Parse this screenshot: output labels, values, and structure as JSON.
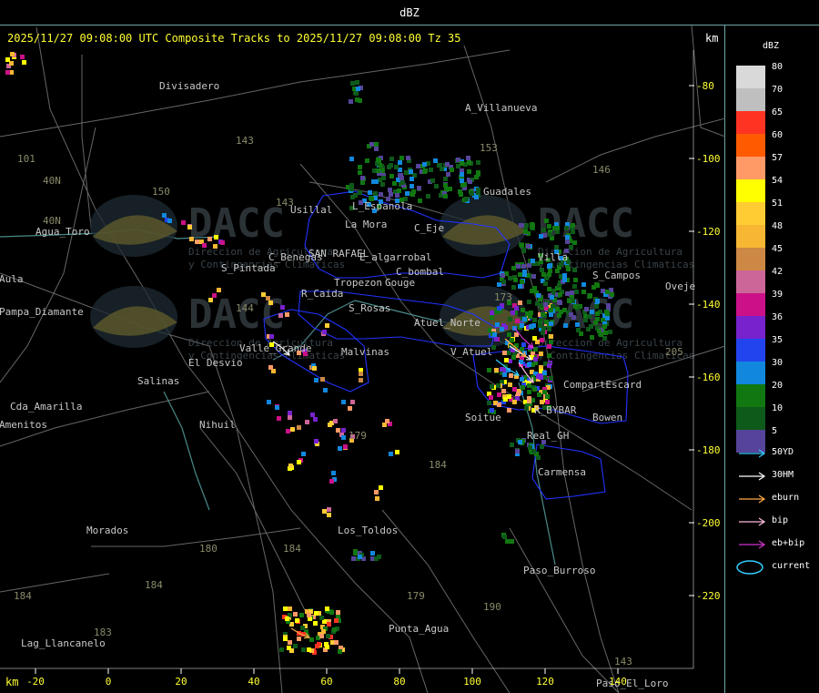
{
  "colors": {
    "frame": "#6fa6a6",
    "header": "#ffff33",
    "boundary": "#2233ff",
    "road": "#666666",
    "place_label": "#c8c8c8",
    "route_label": "#8a8a6a"
  },
  "top_bar": {
    "title": "dBZ"
  },
  "header": {
    "text": "2025/11/27 09:08:00 UTC Composite Tracks to 2025/11/27 09:08:00 Tz 35",
    "km_right": "km",
    "km_bottom": "km"
  },
  "axes": {
    "x_ticks": [
      "-20",
      "0",
      "20",
      "40",
      "60",
      "80",
      "100",
      "120",
      "140"
    ],
    "x_values": [
      -20,
      0,
      20,
      40,
      60,
      80,
      100,
      120,
      140
    ],
    "y_ticks": [
      "-80",
      "-100",
      "-120",
      "-140",
      "-160",
      "-180",
      "-200",
      "-220"
    ],
    "y_values": [
      -80,
      -100,
      -120,
      -140,
      -160,
      -180,
      -200,
      -220
    ],
    "x_range": [
      -30,
      160
    ],
    "y_range": [
      -75,
      -248
    ]
  },
  "legend": {
    "title": "dBZ",
    "items": [
      {
        "value": "80",
        "color": "#d9d9d9"
      },
      {
        "value": "70",
        "color": "#bfbfbf"
      },
      {
        "value": "65",
        "color": "#ff3322"
      },
      {
        "value": "60",
        "color": "#ff5a00"
      },
      {
        "value": "57",
        "color": "#ff9966"
      },
      {
        "value": "54",
        "color": "#ffff00"
      },
      {
        "value": "51",
        "color": "#ffcc33"
      },
      {
        "value": "48",
        "color": "#f7b733"
      },
      {
        "value": "45",
        "color": "#cc8844"
      },
      {
        "value": "42",
        "color": "#cc6699"
      },
      {
        "value": "39",
        "color": "#cc1188"
      },
      {
        "value": "36",
        "color": "#7722cc"
      },
      {
        "value": "35",
        "color": "#2244ee"
      },
      {
        "value": "30",
        "color": "#1188dd"
      },
      {
        "value": "20",
        "color": "#117711"
      },
      {
        "value": "10",
        "color": "#0e5a1a"
      },
      {
        "value": "5",
        "color": "#554499"
      }
    ],
    "tracks": [
      {
        "label": "50YD",
        "color": "#33ccff",
        "icon": "arrow"
      },
      {
        "label": "30HM",
        "color": "#ffffff",
        "icon": "arrow"
      },
      {
        "label": "eburn",
        "color": "#ffaa44",
        "icon": "arrow"
      },
      {
        "label": "bip",
        "color": "#ffbbdd",
        "icon": "arrow"
      },
      {
        "label": "eb+bip",
        "color": "#cc33cc",
        "icon": "arrow"
      },
      {
        "label": "current",
        "color": "#33ccff",
        "icon": "ellipse"
      }
    ]
  },
  "places": [
    {
      "name": "Divisadero",
      "x": 14,
      "y": -81
    },
    {
      "name": "A_Villanueva",
      "x": 98,
      "y": -87
    },
    {
      "name": "Guadales",
      "x": 103,
      "y": -110
    },
    {
      "name": "Usillal",
      "x": 50,
      "y": -115
    },
    {
      "name": "L_Espanola",
      "x": 67,
      "y": -114
    },
    {
      "name": "Agua_Toro",
      "x": -20,
      "y": -121
    },
    {
      "name": "C_Eje",
      "x": 84,
      "y": -120
    },
    {
      "name": "Villa",
      "x": 118,
      "y": -128
    },
    {
      "name": "S_Campos",
      "x": 133,
      "y": -133
    },
    {
      "name": "Oveje",
      "x": 153,
      "y": -136
    },
    {
      "name": "Aula",
      "x": -30,
      "y": -134
    },
    {
      "name": "Pampa_Diamante",
      "x": -30,
      "y": -143
    },
    {
      "name": "La Mora",
      "x": 65,
      "y": -119
    },
    {
      "name": "C_Benegas",
      "x": 44,
      "y": -128
    },
    {
      "name": "SAN RAFAEL",
      "x": 55,
      "y": -127
    },
    {
      "name": "E_algarrobal",
      "x": 69,
      "y": -128
    },
    {
      "name": "C_bombal",
      "x": 79,
      "y": -132
    },
    {
      "name": "Tropezon",
      "x": 62,
      "y": -135
    },
    {
      "name": "Gouge",
      "x": 76,
      "y": -135
    },
    {
      "name": "R_Caida",
      "x": 53,
      "y": -138
    },
    {
      "name": "S_Rosas",
      "x": 66,
      "y": -142
    },
    {
      "name": "S_Pintada",
      "x": 31,
      "y": -131
    },
    {
      "name": "Atuel_Norte",
      "x": 84,
      "y": -146
    },
    {
      "name": "El Desvio",
      "x": 22,
      "y": -157
    },
    {
      "name": "Valle_Grande",
      "x": 36,
      "y": -153
    },
    {
      "name": "Malvinas",
      "x": 64,
      "y": -154
    },
    {
      "name": "V_Atuel",
      "x": 94,
      "y": -154
    },
    {
      "name": "Salinas",
      "x": 8,
      "y": -162
    },
    {
      "name": "CompartEscard",
      "x": 125,
      "y": -163
    },
    {
      "name": "Cda_Amarilla",
      "x": -27,
      "y": -169
    },
    {
      "name": "Soitue",
      "x": 98,
      "y": -172
    },
    {
      "name": "R_BYBAR",
      "x": 117,
      "y": -170
    },
    {
      "name": "Bowen",
      "x": 133,
      "y": -172
    },
    {
      "name": "Nihuil",
      "x": 25,
      "y": -174
    },
    {
      "name": "Amenitos",
      "x": -30,
      "y": -174
    },
    {
      "name": "Real_GH",
      "x": 115,
      "y": -177
    },
    {
      "name": "Carmensa",
      "x": 118,
      "y": -187
    },
    {
      "name": "Los_Toldos",
      "x": 63,
      "y": -203
    },
    {
      "name": "Morados",
      "x": -6,
      "y": -203
    },
    {
      "name": "Paso_Burroso",
      "x": 114,
      "y": -214
    },
    {
      "name": "Punta_Agua",
      "x": 77,
      "y": -230
    },
    {
      "name": "Lag_Llancanelo",
      "x": -24,
      "y": -234
    },
    {
      "name": "Paso_El_Loro",
      "x": 134,
      "y": -245
    }
  ],
  "routes": [
    {
      "name": "143",
      "x": 35,
      "y": -96
    },
    {
      "name": "153",
      "x": 102,
      "y": -98
    },
    {
      "name": "146",
      "x": 133,
      "y": -104
    },
    {
      "name": "150",
      "x": 12,
      "y": -110
    },
    {
      "name": "143",
      "x": 46,
      "y": -113
    },
    {
      "name": "40N",
      "x": -18,
      "y": -118
    },
    {
      "name": "40N",
      "x": -18,
      "y": -107
    },
    {
      "name": "101",
      "x": -25,
      "y": -101
    },
    {
      "name": "173",
      "x": 106,
      "y": -139
    },
    {
      "name": "144",
      "x": 35,
      "y": -142
    },
    {
      "name": "205",
      "x": 153,
      "y": -154
    },
    {
      "name": "179",
      "x": 66,
      "y": -177
    },
    {
      "name": "184",
      "x": 88,
      "y": -185
    },
    {
      "name": "180",
      "x": 25,
      "y": -208
    },
    {
      "name": "184",
      "x": 48,
      "y": -208
    },
    {
      "name": "184",
      "x": 10,
      "y": -218
    },
    {
      "name": "179",
      "x": 82,
      "y": -221
    },
    {
      "name": "190",
      "x": 103,
      "y": -224
    },
    {
      "name": "184",
      "x": -26,
      "y": -221
    },
    {
      "name": "183",
      "x": -4,
      "y": -231
    },
    {
      "name": "143",
      "x": 139,
      "y": -239
    }
  ],
  "watermarks": [
    {
      "big": "DACC",
      "small": "Direccion de Agricultura",
      "small2": "y Contingencias Climaticas",
      "x": 22,
      "y": -118
    },
    {
      "big": "DACC",
      "small": "Direccion de Agricultura",
      "small2": "y Contingencias Climaticas",
      "x": 118,
      "y": -118
    },
    {
      "big": "DACC",
      "small": "Direccion de Agricultura",
      "small2": "y Contingencias Climaticas",
      "x": 22,
      "y": -143
    },
    {
      "big": "DACC",
      "small": "Direccion de Agricultura",
      "small2": "y Contingencias Climaticas",
      "x": 118,
      "y": -143
    }
  ]
}
